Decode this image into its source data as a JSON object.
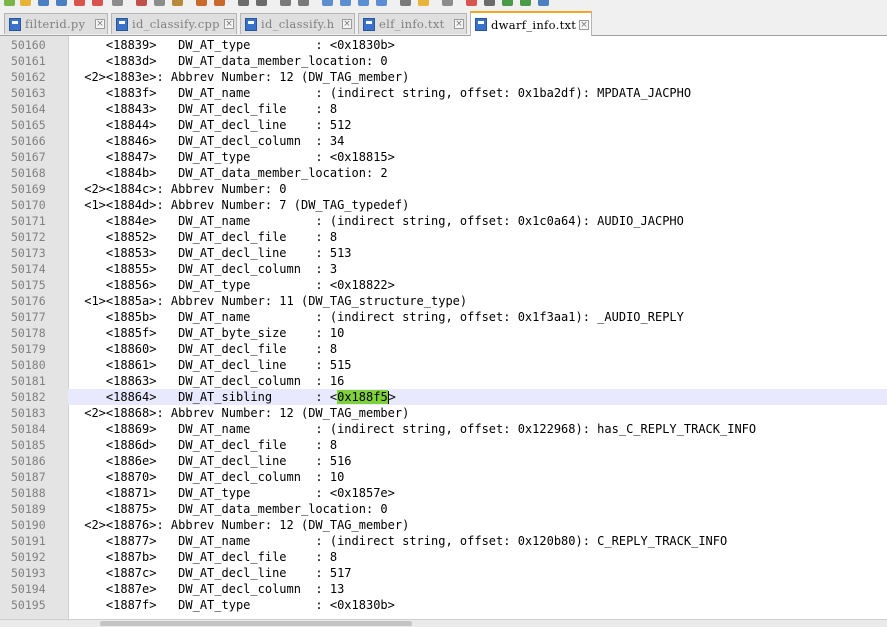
{
  "tabs": [
    {
      "label": "filterid.py",
      "active": false
    },
    {
      "label": "id_classify.cpp",
      "active": false
    },
    {
      "label": "id_classify.h",
      "active": false
    },
    {
      "label": "elf_info.txt",
      "active": false
    },
    {
      "label": "dwarf_info.txt",
      "active": true
    }
  ],
  "close_glyph": "×",
  "lines": [
    {
      "num": "50160",
      "text": "    <18839>   DW_AT_type         : <0x1830b>"
    },
    {
      "num": "50161",
      "text": "    <1883d>   DW_AT_data_member_location: 0"
    },
    {
      "num": "50162",
      "text": " <2><1883e>: Abbrev Number: 12 (DW_TAG_member)"
    },
    {
      "num": "50163",
      "text": "    <1883f>   DW_AT_name         : (indirect string, offset: 0x1ba2df): MPDATA_JACPHO"
    },
    {
      "num": "50164",
      "text": "    <18843>   DW_AT_decl_file    : 8"
    },
    {
      "num": "50165",
      "text": "    <18844>   DW_AT_decl_line    : 512"
    },
    {
      "num": "50166",
      "text": "    <18846>   DW_AT_decl_column  : 34"
    },
    {
      "num": "50167",
      "text": "    <18847>   DW_AT_type         : <0x18815>"
    },
    {
      "num": "50168",
      "text": "    <1884b>   DW_AT_data_member_location: 2"
    },
    {
      "num": "50169",
      "text": " <2><1884c>: Abbrev Number: 0"
    },
    {
      "num": "50170",
      "text": " <1><1884d>: Abbrev Number: 7 (DW_TAG_typedef)"
    },
    {
      "num": "50171",
      "text": "    <1884e>   DW_AT_name         : (indirect string, offset: 0x1c0a64): AUDIO_JACPHO"
    },
    {
      "num": "50172",
      "text": "    <18852>   DW_AT_decl_file    : 8"
    },
    {
      "num": "50173",
      "text": "    <18853>   DW_AT_decl_line    : 513"
    },
    {
      "num": "50174",
      "text": "    <18855>   DW_AT_decl_column  : 3"
    },
    {
      "num": "50175",
      "text": "    <18856>   DW_AT_type         : <0x18822>"
    },
    {
      "num": "50176",
      "text": " <1><1885a>: Abbrev Number: 11 (DW_TAG_structure_type)"
    },
    {
      "num": "50177",
      "text": "    <1885b>   DW_AT_name         : (indirect string, offset: 0x1f3aa1): _AUDIO_REPLY"
    },
    {
      "num": "50178",
      "text": "    <1885f>   DW_AT_byte_size    : 10"
    },
    {
      "num": "50179",
      "text": "    <18860>   DW_AT_decl_file    : 8"
    },
    {
      "num": "50180",
      "text": "    <18861>   DW_AT_decl_line    : 515"
    },
    {
      "num": "50181",
      "text": "    <18863>   DW_AT_decl_column  : 16"
    },
    {
      "num": "50182",
      "text": "    <18864>   DW_AT_sibling      : <0x188f5>",
      "current": true,
      "pre": "    <18864>   DW_AT_sibling      : <",
      "highlight": "0x188f5",
      "post": ">"
    },
    {
      "num": "50183",
      "text": " <2><18868>: Abbrev Number: 12 (DW_TAG_member)"
    },
    {
      "num": "50184",
      "text": "    <18869>   DW_AT_name         : (indirect string, offset: 0x122968): has_C_REPLY_TRACK_INFO"
    },
    {
      "num": "50185",
      "text": "    <1886d>   DW_AT_decl_file    : 8"
    },
    {
      "num": "50186",
      "text": "    <1886e>   DW_AT_decl_line    : 516"
    },
    {
      "num": "50187",
      "text": "    <18870>   DW_AT_decl_column  : 10"
    },
    {
      "num": "50188",
      "text": "    <18871>   DW_AT_type         : <0x1857e>"
    },
    {
      "num": "50189",
      "text": "    <18875>   DW_AT_data_member_location: 0"
    },
    {
      "num": "50190",
      "text": " <2><18876>: Abbrev Number: 12 (DW_TAG_member)"
    },
    {
      "num": "50191",
      "text": "    <18877>   DW_AT_name         : (indirect string, offset: 0x120b80): C_REPLY_TRACK_INFO"
    },
    {
      "num": "50192",
      "text": "    <1887b>   DW_AT_decl_file    : 8"
    },
    {
      "num": "50193",
      "text": "    <1887c>   DW_AT_decl_line    : 517"
    },
    {
      "num": "50194",
      "text": "    <1887e>   DW_AT_decl_column  : 13"
    },
    {
      "num": "50195",
      "text": "    <1887f>   DW_AT_type         : <0x1830b>"
    }
  ],
  "colors": {
    "active_tab_accent": "#f5a623",
    "current_line": "#e8e8ff",
    "match_highlight": "#7fd13b",
    "gutter": "#e4e4e4",
    "line_number": "#808080"
  }
}
